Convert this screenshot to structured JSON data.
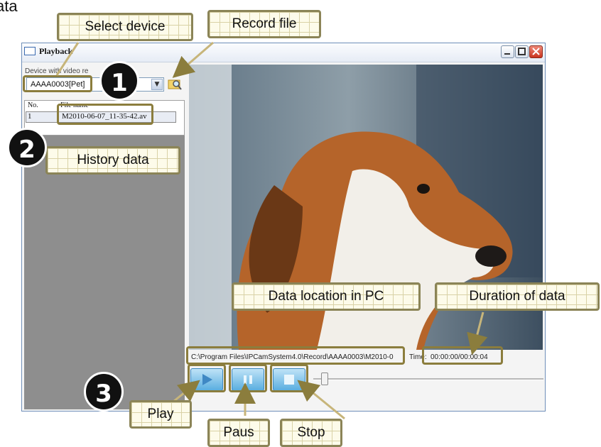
{
  "top_left_text": "ata",
  "window": {
    "title": "Playback",
    "device_label": "Device with video re",
    "device_value": "AAAA0003[Pet]",
    "table_headers": [
      "No.",
      "File name"
    ],
    "rows": [
      {
        "no": "1",
        "file": "M2010-06-07_11-35-42.av"
      }
    ],
    "path": "C:\\Program Files\\IPCamSystem4.0\\Record\\AAAA0003\\M2010-0",
    "time_label": "Time:",
    "time_value": "00:00:00/00:00:04"
  },
  "badges": {
    "one": "1",
    "two": "2",
    "three": "3"
  },
  "callouts": {
    "select_device": "Select device",
    "record_file": "Record file",
    "history_data": "History data",
    "data_location": "Data location in PC",
    "duration": "Duration of data",
    "play": "Play",
    "pause": "Paus",
    "stop": "Stop"
  },
  "colors": {
    "accent": "#8b7d3d",
    "control_blue": "#5aaee0",
    "callout_bg": "#fdfbea"
  }
}
